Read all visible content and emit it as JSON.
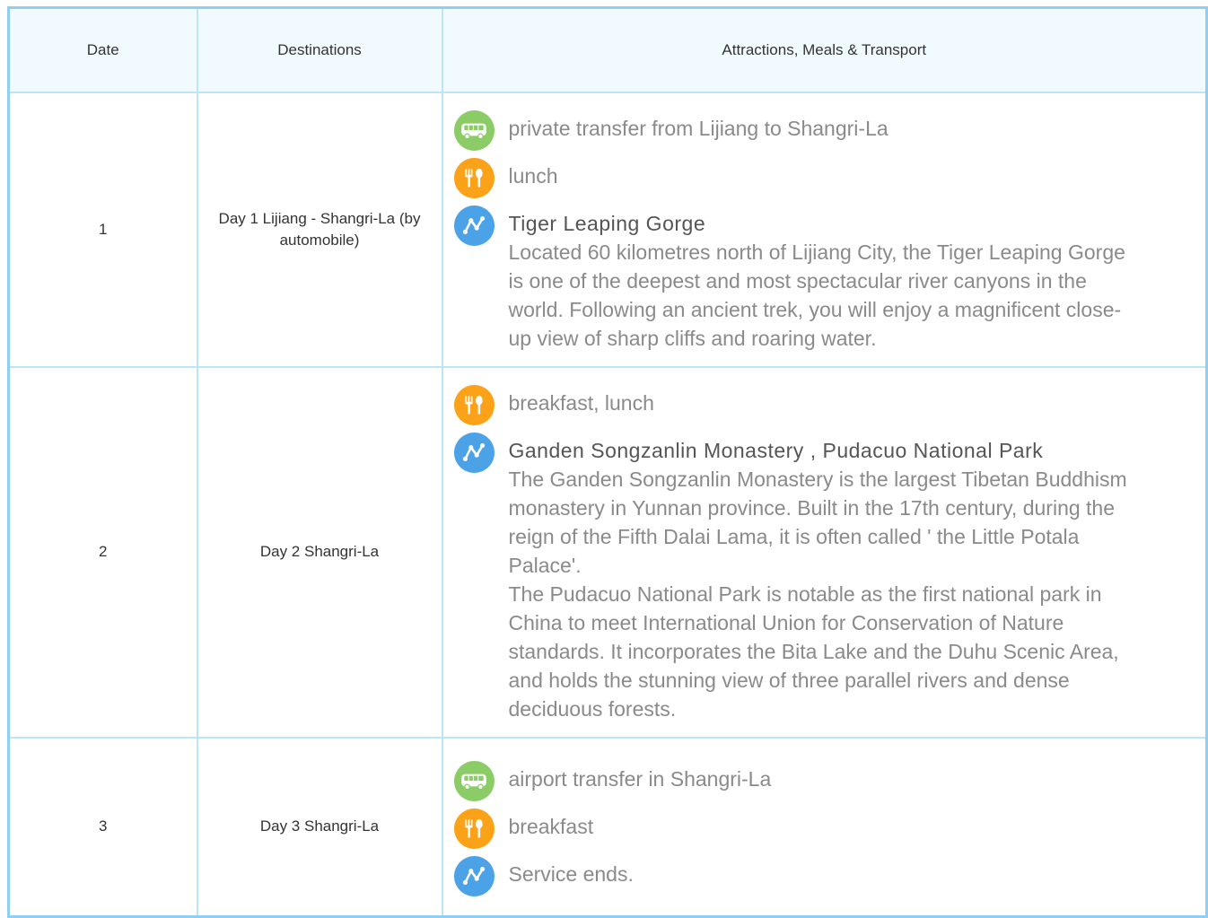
{
  "header": {
    "date": "Date",
    "destinations": "Destinations",
    "details": "Attractions, Meals & Transport"
  },
  "days": [
    {
      "date": "1",
      "destination": "Day 1 Lijiang - Shangri-La (by automobile)",
      "transport": "private transfer from Lijiang to Shangri-La",
      "meals": "lunch",
      "sight_title": "Tiger Leaping Gorge",
      "sight_desc": "Located 60 kilometres north of Lijiang City, the Tiger Leaping Gorge is one of the deepest and most spectacular river canyons in the world. Following an ancient trek, you will enjoy a magnificent close-up view of sharp cliffs and roaring water."
    },
    {
      "date": "2",
      "destination": "Day 2 Shangri-La",
      "meals": "breakfast, lunch",
      "sight_title": "Ganden Songzanlin Monastery , Pudacuo National Park",
      "sight_desc_1": "The Ganden Songzanlin Monastery is the largest Tibetan Buddhism monastery in Yunnan province. Built in the 17th century, during the reign of the Fifth Dalai Lama, it is often called ' the Little Potala Palace'.",
      "sight_desc_2": "The Pudacuo National Park is notable as the first national park in China to meet International Union for Conservation of Nature standards. It incorporates the Bita Lake and the Duhu Scenic Area, and holds the stunning view of three parallel rivers and dense deciduous forests."
    },
    {
      "date": "3",
      "destination": "Day 3 Shangri-La",
      "transport": "airport transfer in Shangri-La",
      "meals": "breakfast",
      "sight": "Service ends."
    }
  ],
  "icons": {
    "transport": "bus-icon",
    "meals": "fork-knife-icon",
    "sight": "route-icon"
  },
  "colors": {
    "border": "#8fcff3",
    "header_bg": "#f1fbff",
    "bus": "#8ccc67",
    "meal": "#fba219",
    "sight": "#4ca2e7"
  }
}
